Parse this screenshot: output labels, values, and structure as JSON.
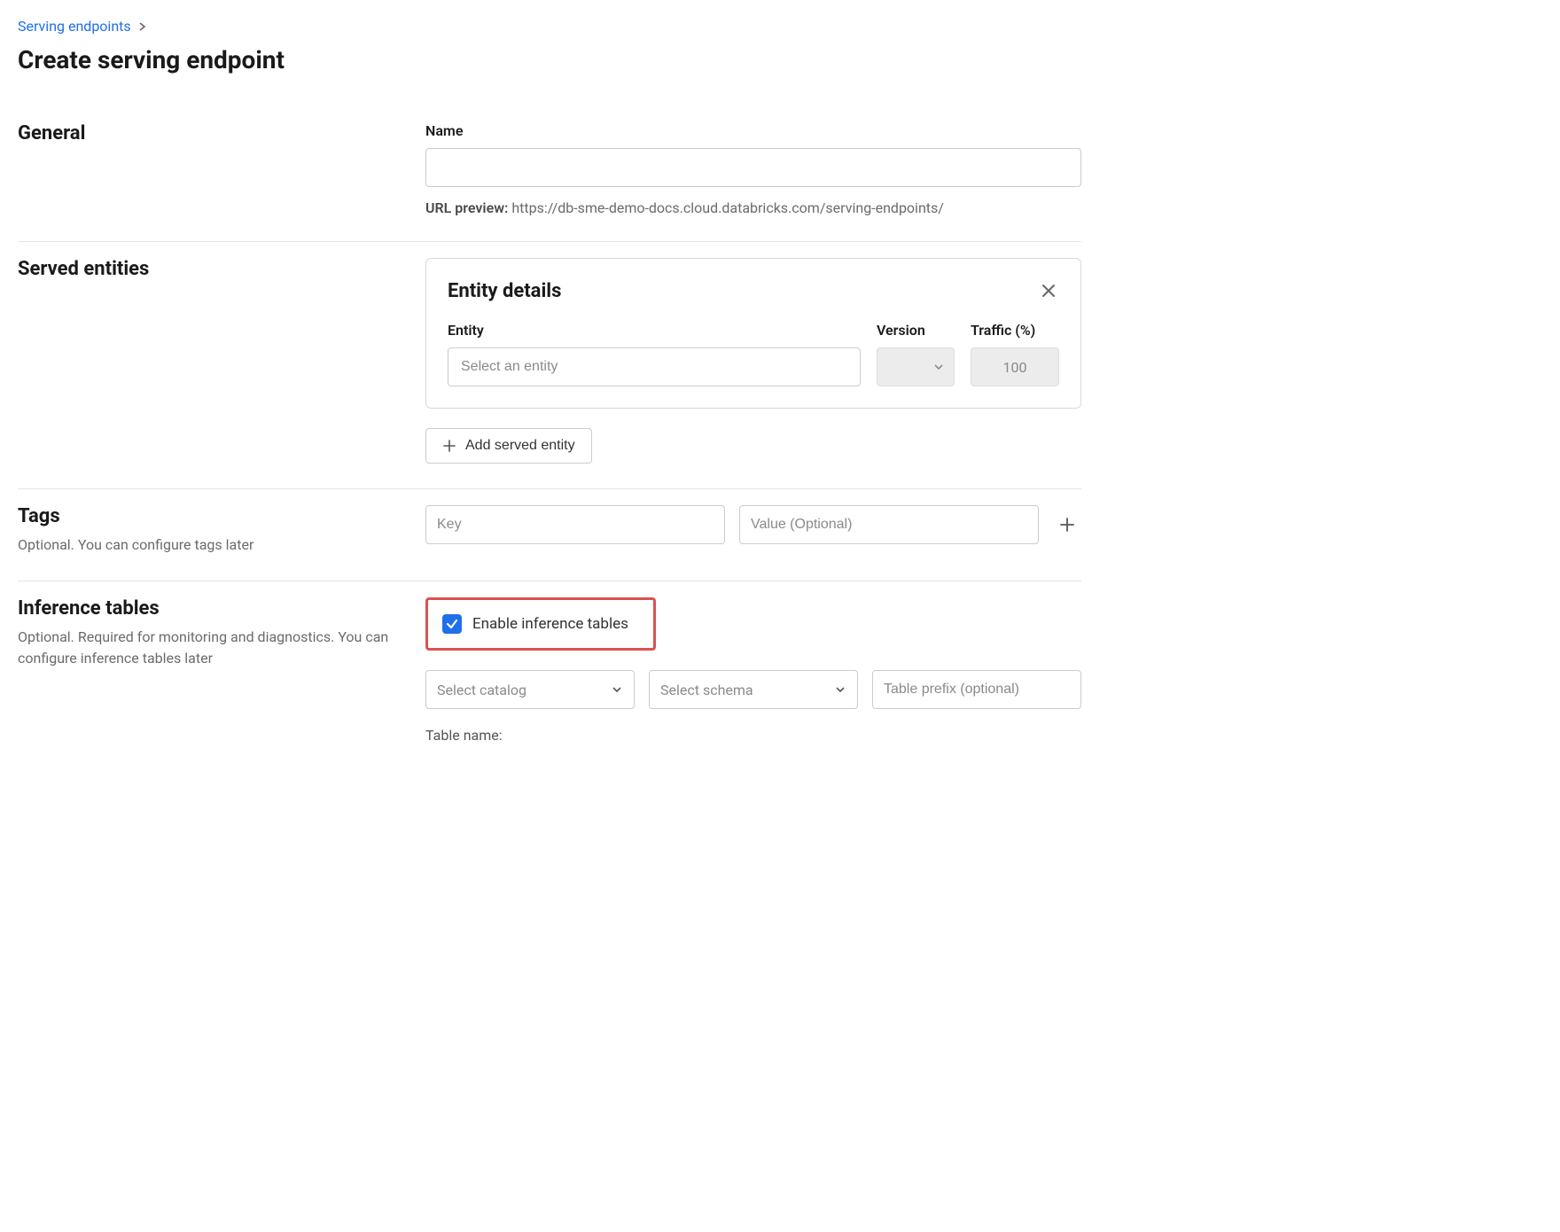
{
  "breadcrumb": {
    "parent": "Serving endpoints"
  },
  "page": {
    "title": "Create serving endpoint"
  },
  "general": {
    "heading": "General",
    "name_label": "Name",
    "name_value": "",
    "url_preview_label": "URL preview:",
    "url_preview_value": "https://db-sme-demo-docs.cloud.databricks.com/serving-endpoints/"
  },
  "served": {
    "heading": "Served entities",
    "card_title": "Entity details",
    "entity_label": "Entity",
    "version_label": "Version",
    "traffic_label": "Traffic (%)",
    "entity_placeholder": "Select an entity",
    "version_value": "",
    "traffic_value": "100",
    "add_button": "Add served entity"
  },
  "tags": {
    "heading": "Tags",
    "desc": "Optional. You can configure tags later",
    "key_placeholder": "Key",
    "value_placeholder": "Value (Optional)"
  },
  "inference": {
    "heading": "Inference tables",
    "desc": "Optional. Required for monitoring and diagnostics. You can configure inference tables later",
    "checkbox_label": "Enable inference tables",
    "checked": true,
    "catalog_placeholder": "Select catalog",
    "schema_placeholder": "Select schema",
    "prefix_placeholder": "Table prefix (optional)",
    "table_name_label": "Table name:"
  }
}
